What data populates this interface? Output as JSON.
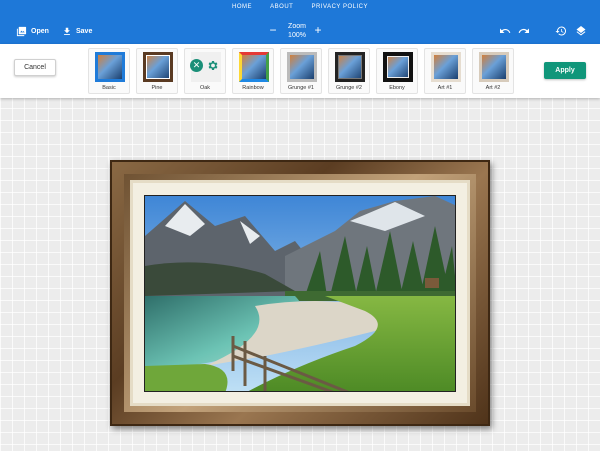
{
  "nav": {
    "items": [
      "HOME",
      "ABOUT",
      "PRIVACY POLICY"
    ]
  },
  "toolbar": {
    "open_label": "Open",
    "save_label": "Save",
    "zoom_label": "Zoom",
    "zoom_value": "100%",
    "zoom_out_symbol": "−",
    "zoom_in_symbol": "+",
    "icons": [
      "open-images-icon",
      "download-icon",
      "undo-icon",
      "redo-icon",
      "history-icon",
      "layers-icon"
    ]
  },
  "actions": {
    "cancel_label": "Cancel",
    "apply_label": "Apply"
  },
  "frames": [
    {
      "label": "Basic",
      "style": "basic"
    },
    {
      "label": "Pine",
      "style": "pine"
    },
    {
      "label": "Oak",
      "style": "oak"
    },
    {
      "label": "Rainbow",
      "style": "rainbow"
    },
    {
      "label": "Grunge #1",
      "style": "grunge1"
    },
    {
      "label": "Grunge #2",
      "style": "grunge2"
    },
    {
      "label": "Ebony",
      "style": "ebony"
    },
    {
      "label": "Art #1",
      "style": "art1"
    },
    {
      "label": "Art #2",
      "style": "art2"
    }
  ],
  "colors": {
    "topbar": "#1e78d8",
    "apply": "#10967a",
    "canvas_bg": "#ececec"
  }
}
